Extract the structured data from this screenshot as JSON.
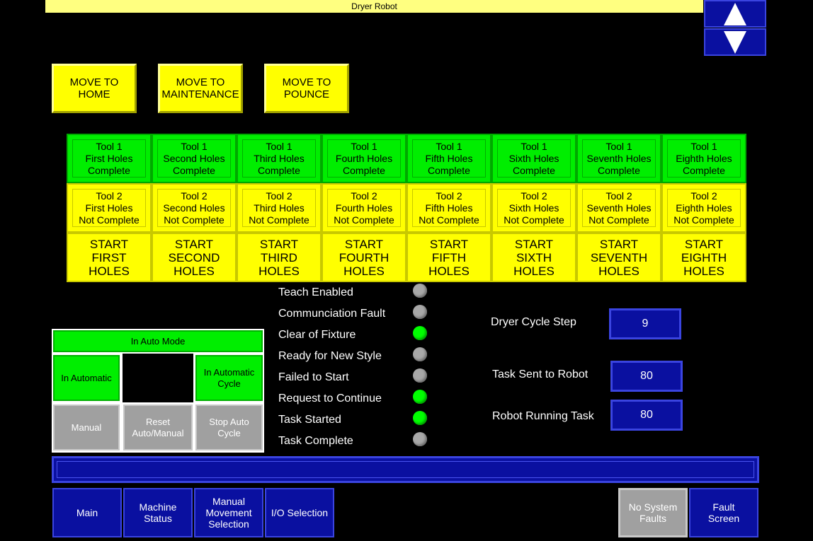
{
  "header": {
    "title": "Dryer Robot"
  },
  "nav": {
    "up_icon": "up-arrow-icon",
    "down_icon": "down-arrow-icon"
  },
  "move_buttons": [
    "MOVE TO\nHOME",
    "MOVE TO\nMAINTENANCE",
    "MOVE TO\nPOUNCE"
  ],
  "tool1_row": [
    "Tool 1\nFirst Holes\nComplete",
    "Tool 1\nSecond Holes\nComplete",
    "Tool 1\nThird Holes\nComplete",
    "Tool 1\nFourth Holes\nComplete",
    "Tool 1\nFifth Holes\nComplete",
    "Tool 1\nSixth Holes\nComplete",
    "Tool 1\nSeventh Holes\nComplete",
    "Tool 1\nEighth Holes\nComplete"
  ],
  "tool2_row": [
    "Tool 2\nFirst Holes\nNot Complete",
    "Tool 2\nSecond Holes\nNot Complete",
    "Tool 2\nThird Holes\nNot Complete",
    "Tool 2\nFourth Holes\nNot Complete",
    "Tool 2\nFifth Holes\nNot Complete",
    "Tool 2\nSixth Holes\nNot Complete",
    "Tool 2\nSeventh Holes\nNot Complete",
    "Tool 2\nEighth Holes\nNot Complete"
  ],
  "start_row": [
    "START\nFIRST\nHOLES",
    "START\nSECOND\nHOLES",
    "START\nTHIRD\nHOLES",
    "START\nFOURTH\nHOLES",
    "START\nFIFTH\nHOLES",
    "START\nSIXTH\nHOLES",
    "START\nSEVENTH\nHOLES",
    "START\nEIGHTH\nHOLES"
  ],
  "status": [
    {
      "label": "Teach Enabled",
      "on": false
    },
    {
      "label": "Communciation Fault",
      "on": false
    },
    {
      "label": "Clear of Fixture",
      "on": true
    },
    {
      "label": "Ready for New Style",
      "on": false
    },
    {
      "label": "Failed to Start",
      "on": false
    },
    {
      "label": "Request to Continue",
      "on": true
    },
    {
      "label": "Task Started",
      "on": true
    },
    {
      "label": "Task Complete",
      "on": false
    }
  ],
  "auto": {
    "mode": "In Auto Mode",
    "in_automatic": "In Automatic",
    "in_automatic_cycle": "In Automatic\nCycle",
    "manual": "Manual",
    "reset": "Reset\nAuto/Manual",
    "stop": "Stop Auto\nCycle"
  },
  "values": {
    "cycle_step_label": "Dryer Cycle Step",
    "cycle_step": "9",
    "task_sent_label": "Task Sent to Robot",
    "task_sent": "80",
    "running_label": "Robot Running Task",
    "running": "80"
  },
  "message_bar": "",
  "bottom_nav": {
    "main": "Main",
    "machine_status": "Machine\nStatus",
    "manual_movement": "Manual\nMovement\nSelection",
    "io_selection": "I/O Selection",
    "no_faults": "No System\nFaults",
    "fault_screen": "Fault\nScreen"
  },
  "colors": {
    "green": "#00ee00",
    "yellow": "#ffff00",
    "blue": "#0a10a0",
    "gray": "#a0a0a0"
  }
}
